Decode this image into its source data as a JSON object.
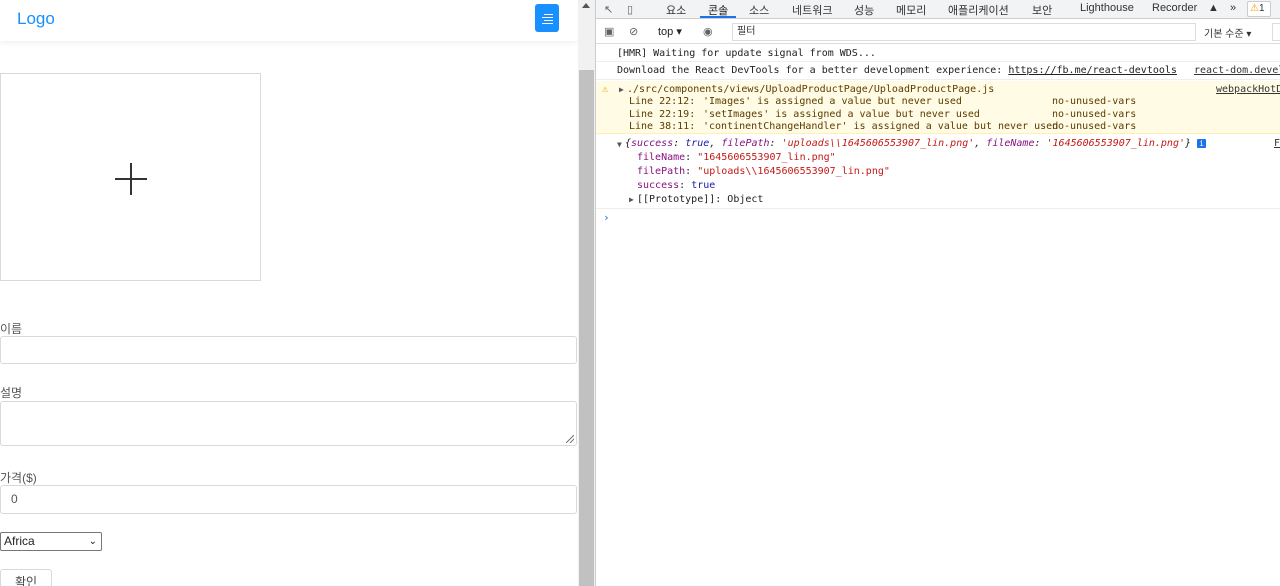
{
  "app": {
    "logo": "Logo",
    "form": {
      "name_label": "이름",
      "description_label": "설명",
      "price_label": "가격($)",
      "price_value": "0",
      "continent_selected": "Africa",
      "submit_label": "확인"
    }
  },
  "devtools": {
    "tabs": [
      "요소",
      "콘솔",
      "소스",
      "네트워크",
      "성능",
      "메모리",
      "애플리케이션",
      "보안",
      "Lighthouse",
      "Recorder"
    ],
    "active_tab": "콘솔",
    "more_tabs": "»",
    "warning_count": "1",
    "toolbar": {
      "context": "top",
      "filter_value": "필터",
      "levels": "기본 수준"
    },
    "console": {
      "hmr": "[HMR] Waiting for update signal from WDS...",
      "devtools_msg": "Download the React DevTools for a better development experience: ",
      "devtools_link": "https://fb.me/react-devtools",
      "devtools_source": "react-dom.devel",
      "warning": {
        "file": "./src/components/views/UploadProductPage/UploadProductPage.js",
        "source": "webpackHotD",
        "lines": [
          {
            "pos": "Line 22:12:",
            "msg": "'Images' is assigned a value but never used",
            "rule": "no-unused-vars"
          },
          {
            "pos": "Line 22:19:",
            "msg": "'setImages' is assigned a value but never used",
            "rule": "no-unused-vars"
          },
          {
            "pos": "Line 38:11:",
            "msg": "'continentChangeHandler' is assigned a value but never used",
            "rule": "no-unused-vars"
          }
        ]
      },
      "object_summary": {
        "open": "{",
        "k1": "success",
        "v1": "true",
        "k2": "filePath",
        "v2": "'uploads\\\\1645606553907_lin.png'",
        "k3": "fileName",
        "v3": "'1645606553907_lin.png'",
        "close": "}"
      },
      "object_source": "F",
      "props": [
        {
          "key": "fileName",
          "value": "\"1645606553907_lin.png\""
        },
        {
          "key": "filePath",
          "value": "\"uploads\\\\1645606553907_lin.png\""
        },
        {
          "key": "success",
          "value": "true"
        }
      ],
      "prototype": "[[Prototype]]: Object"
    }
  }
}
